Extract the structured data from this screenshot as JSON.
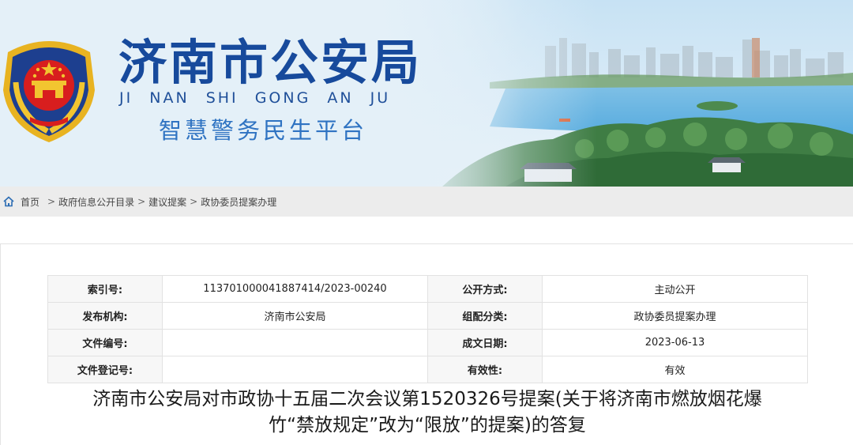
{
  "header": {
    "site_title": "济南市公安局",
    "site_pinyin": "JI NAN SHI GONG AN JU",
    "site_subtitle": "智慧警务民生平台"
  },
  "breadcrumb": {
    "items": [
      "首页",
      "政府信息公开目录",
      "建议提案",
      "政协委员提案办理"
    ],
    "separator": ">"
  },
  "info": {
    "rows": [
      {
        "label1": "索引号:",
        "value1": "113701000041887414/2023-00240",
        "label2": "公开方式:",
        "value2": "主动公开"
      },
      {
        "label1": "发布机构:",
        "value1": "济南市公安局",
        "label2": "组配分类:",
        "value2": "政协委员提案办理"
      },
      {
        "label1": "文件编号:",
        "value1": "",
        "label2": "成文日期:",
        "value2": "2023-06-13"
      },
      {
        "label1": "文件登记号:",
        "value1": "",
        "label2": "有效性:",
        "value2": "有效"
      }
    ]
  },
  "document": {
    "title_line1": "济南市公安局对市政协十五届二次会议第1520326号提案(关于将济南市燃放烟花爆",
    "title_line2": "竹“禁放规定”改为“限放”的提案)的答复"
  },
  "colors": {
    "title_blue": "#174a9c",
    "subtitle_blue": "#2f73c2",
    "breadcrumb_bg": "#ececec",
    "label_bg": "#f7f7f7"
  },
  "icons": {
    "emblem": "police-emblem-icon",
    "home": "home-icon"
  }
}
